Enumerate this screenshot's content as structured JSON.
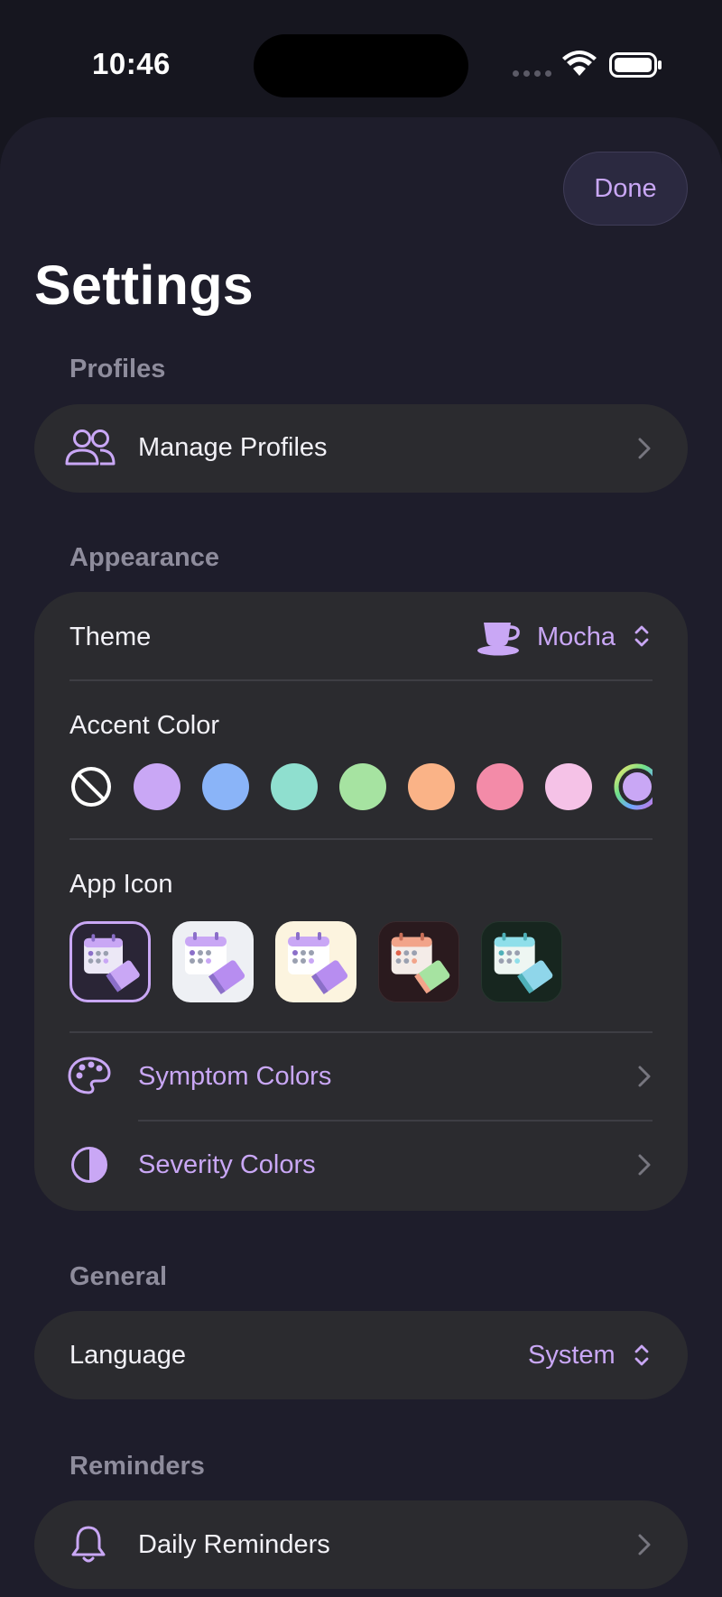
{
  "status_bar": {
    "time": "10:46"
  },
  "header": {
    "done_label": "Done",
    "title": "Settings"
  },
  "sections": {
    "profiles": {
      "label": "Profiles",
      "manage_label": "Manage Profiles"
    },
    "appearance": {
      "label": "Appearance",
      "theme_label": "Theme",
      "theme_value": "Mocha",
      "accent_label": "Accent Color",
      "accent_colors": [
        "#c9a7f5",
        "#8ab4f8",
        "#8fdfcf",
        "#a6e3a1",
        "#fab387",
        "#f38ba8",
        "#f5c2e7"
      ],
      "app_icon_label": "App Icon",
      "symptom_colors_label": "Symptom Colors",
      "severity_colors_label": "Severity Colors"
    },
    "general": {
      "label": "General",
      "language_label": "Language",
      "language_value": "System"
    },
    "reminders": {
      "label": "Reminders",
      "daily_label": "Daily Reminders"
    }
  },
  "colors": {
    "accent": "#c9a7f5",
    "background": "#1e1d2b",
    "card": "#2b2b2f"
  }
}
